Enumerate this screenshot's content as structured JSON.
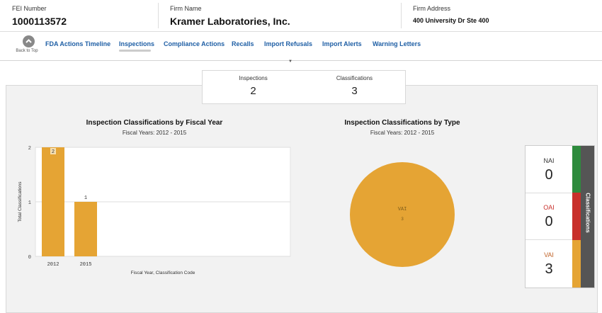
{
  "header": {
    "fei": {
      "label": "FEI Number",
      "value": "1000113572"
    },
    "firm": {
      "label": "Firm Name",
      "value": "Kramer Laboratories, Inc."
    },
    "address": {
      "label": "Firm Address",
      "value": "400 University Dr Ste 400"
    }
  },
  "nav": {
    "back_to_top": "Back to Top",
    "items": [
      {
        "label": "FDA Actions Timeline"
      },
      {
        "label": "Inspections"
      },
      {
        "label": "Compliance Actions"
      },
      {
        "label": "Recalls"
      },
      {
        "label": "Import Refusals"
      },
      {
        "label": "Import Alerts"
      },
      {
        "label": "Warning Letters"
      }
    ],
    "active": "Inspections"
  },
  "summary": {
    "inspections": {
      "label": "Inspections",
      "value": "2"
    },
    "classifications": {
      "label": "Classifications",
      "value": "3"
    }
  },
  "bar_chart": {
    "title": "Inspection Classifications by Fiscal Year",
    "subtitle": "Fiscal Years: 2012 - 2015"
  },
  "pie_chart": {
    "title": "Inspection Classifications by Type",
    "subtitle": "Fiscal Years: 2012 - 2015"
  },
  "cards": {
    "tab_label": "Classifications",
    "items": [
      {
        "label": "NAI",
        "value": "0",
        "color": "#2e8b3d",
        "label_color": "#333333"
      },
      {
        "label": "OAI",
        "value": "0",
        "color": "#c8302b",
        "label_color": "#c8302b"
      },
      {
        "label": "VAI",
        "value": "3",
        "color": "#e5a434",
        "label_color": "#c0642a"
      }
    ]
  },
  "chart_data": [
    {
      "type": "bar",
      "title": "Inspection Classifications by Fiscal Year",
      "subtitle": "Fiscal Years: 2012 - 2015",
      "categories": [
        "2012",
        "2015"
      ],
      "values": [
        2,
        1
      ],
      "data_labels": [
        "2",
        "1"
      ],
      "xlabel": "Fiscal Year, Classification Code",
      "ylabel": "Total Classifications",
      "ylim": [
        0,
        2
      ],
      "yticks": [
        "0",
        "1",
        "2"
      ],
      "grid": true,
      "color": "#e5a434"
    },
    {
      "type": "pie",
      "title": "Inspection Classifications by Type",
      "subtitle": "Fiscal Years: 2012 - 2015",
      "slices": [
        {
          "label": "VAI",
          "value": 3,
          "color": "#e5a434"
        }
      ]
    }
  ]
}
